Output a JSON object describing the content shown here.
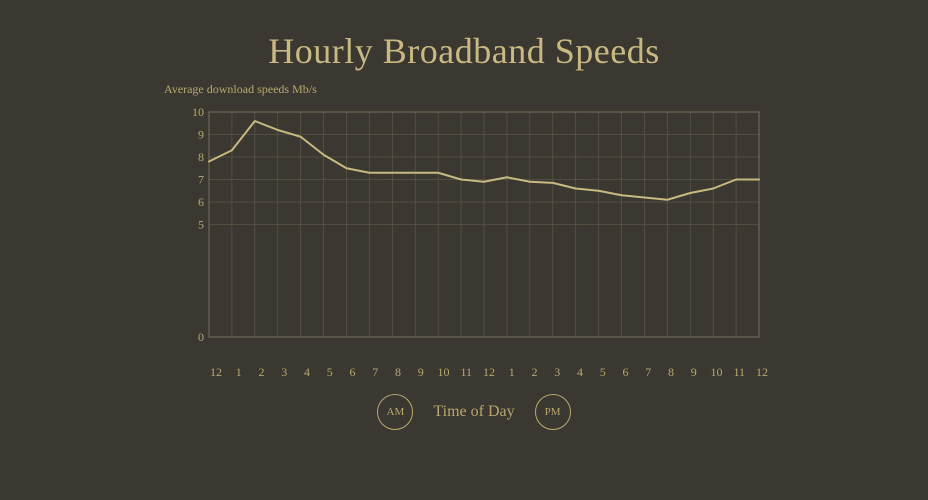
{
  "title": "Hourly Broadband Speeds",
  "yAxisLabel": "Average download speeds Mb/s",
  "xLabels": [
    "12",
    "1",
    "2",
    "3",
    "4",
    "5",
    "6",
    "7",
    "8",
    "9",
    "10",
    "11",
    "12",
    "1",
    "2",
    "3",
    "4",
    "5",
    "6",
    "7",
    "8",
    "9",
    "10",
    "11",
    "12"
  ],
  "timeOfDay": "Time of Day",
  "amLabel": "AM",
  "pmLabel": "PM",
  "yTicks": [
    "10",
    "9",
    "8",
    "7",
    "6",
    "5",
    "0"
  ],
  "colors": {
    "background": "#3a3830",
    "text": "#c8b882",
    "gridLine": "#6a6450",
    "line": "#c8b882",
    "axisLabel": "#b8a870"
  },
  "dataPoints": [
    7.8,
    8.3,
    9.6,
    9.2,
    8.9,
    8.1,
    7.5,
    7.3,
    7.3,
    7.3,
    7.3,
    7.0,
    6.9,
    7.1,
    6.9,
    6.85,
    6.6,
    6.5,
    6.3,
    6.2,
    6.1,
    6.4,
    6.6,
    7.0,
    7.0
  ]
}
